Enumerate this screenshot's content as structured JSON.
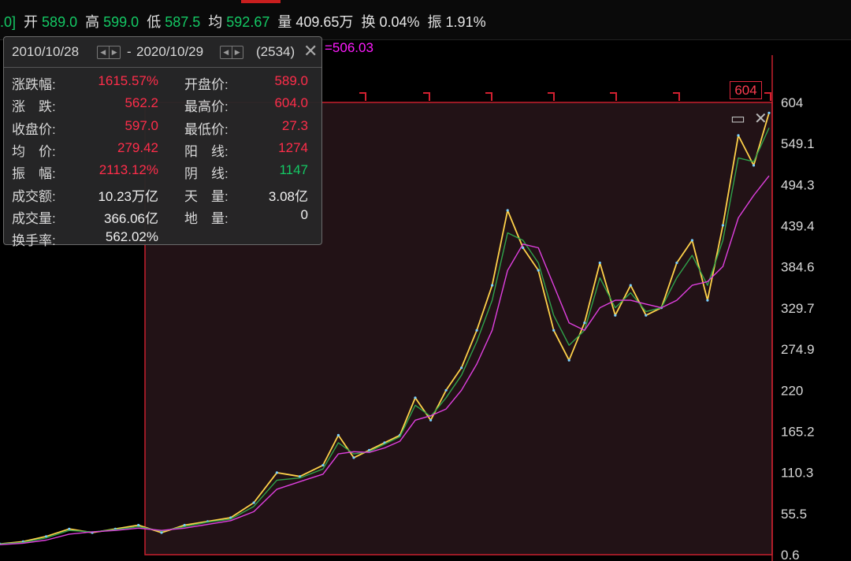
{
  "quote_bar": {
    "prefix": ".0]",
    "open_label": "开",
    "open": "589.0",
    "high_label": "高",
    "high": "599.0",
    "low_label": "低",
    "low": "587.5",
    "avg_label": "均",
    "avg": "592.67",
    "vol_label": "量",
    "vol": "409.65万",
    "turnover_label": "换",
    "turnover": "0.04%",
    "amp_label": "振",
    "amp": "1.91%"
  },
  "ma_value": "=506.03",
  "high_tag": "604",
  "range_box": {
    "start_date": "2010/10/28",
    "separator": "-",
    "end_date": "2020/10/29",
    "count": "(2534)",
    "rows": [
      {
        "l1": "涨跌幅:",
        "v1": "1615.57%",
        "c1": "red",
        "l2": "开盘价:",
        "v2": "589.0",
        "c2": "red"
      },
      {
        "l1": "涨　跌:",
        "v1": "562.2",
        "c1": "red",
        "l2": "最高价:",
        "v2": "604.0",
        "c2": "red"
      },
      {
        "l1": "收盘价:",
        "v1": "597.0",
        "c1": "red",
        "l2": "最低价:",
        "v2": "27.3",
        "c2": "red"
      },
      {
        "l1": "均　价:",
        "v1": "279.42",
        "c1": "red",
        "l2": "阳　线:",
        "v2": "1274",
        "c2": "red"
      },
      {
        "l1": "振　幅:",
        "v1": "2113.12%",
        "c1": "red",
        "l2": "阴　线:",
        "v2": "1147",
        "c2": "green"
      },
      {
        "l1": "成交额:",
        "v1": "10.23万亿",
        "c1": "white",
        "l2": "天　量:",
        "v2": "3.08亿",
        "c2": "white"
      },
      {
        "l1": "成交量:",
        "v1": "366.06亿",
        "c1": "white",
        "l2": "地　量:",
        "v2": "0",
        "c2": "white"
      },
      {
        "l1": "换手率:",
        "v1": "562.02%",
        "c1": "white",
        "l2": "",
        "v2": "",
        "c2": "white"
      }
    ]
  },
  "chart_data": {
    "type": "line",
    "title": "",
    "xlabel": "",
    "ylabel": "",
    "ylim": [
      0.6,
      604
    ],
    "y_ticks": [
      "604",
      "549.1",
      "494.3",
      "439.4",
      "384.6",
      "329.7",
      "274.9",
      "220",
      "165.2",
      "110.3",
      "55.5",
      "0.6"
    ],
    "x": [
      0,
      3,
      6,
      9,
      12,
      15,
      18,
      21,
      24,
      27,
      30,
      33,
      36,
      39,
      42,
      44,
      46,
      48,
      50,
      52,
      54,
      56,
      58,
      60,
      62,
      64,
      66,
      68,
      70,
      72,
      74,
      76,
      78,
      80,
      82,
      84,
      86,
      88,
      90,
      92,
      94,
      96,
      98,
      100
    ],
    "series": [
      {
        "values": [
          15,
          18,
          25,
          35,
          30,
          35,
          40,
          30,
          40,
          45,
          50,
          70,
          110,
          105,
          120,
          160,
          130,
          140,
          150,
          160,
          210,
          180,
          220,
          250,
          300,
          360,
          460,
          410,
          380,
          300,
          260,
          310,
          390,
          320,
          360,
          320,
          330,
          390,
          420,
          340,
          440,
          560,
          520,
          590
        ],
        "color": "#ffd24a"
      },
      {
        "values": [
          15,
          17,
          23,
          33,
          31,
          34,
          38,
          32,
          38,
          44,
          48,
          65,
          100,
          103,
          115,
          150,
          135,
          138,
          148,
          158,
          200,
          185,
          210,
          240,
          285,
          340,
          430,
          420,
          390,
          320,
          280,
          300,
          370,
          330,
          350,
          325,
          330,
          370,
          400,
          360,
          420,
          530,
          525,
          570
        ],
        "color": "#2fa34a"
      },
      {
        "values": [
          14,
          16,
          20,
          28,
          31,
          33,
          36,
          33,
          36,
          41,
          46,
          58,
          88,
          98,
          108,
          135,
          138,
          137,
          143,
          152,
          180,
          186,
          195,
          220,
          255,
          300,
          380,
          415,
          410,
          360,
          310,
          300,
          330,
          340,
          340,
          335,
          330,
          340,
          360,
          365,
          385,
          450,
          480,
          506.03
        ],
        "color": "#e040e0"
      }
    ],
    "legend": "none",
    "grid": false
  }
}
